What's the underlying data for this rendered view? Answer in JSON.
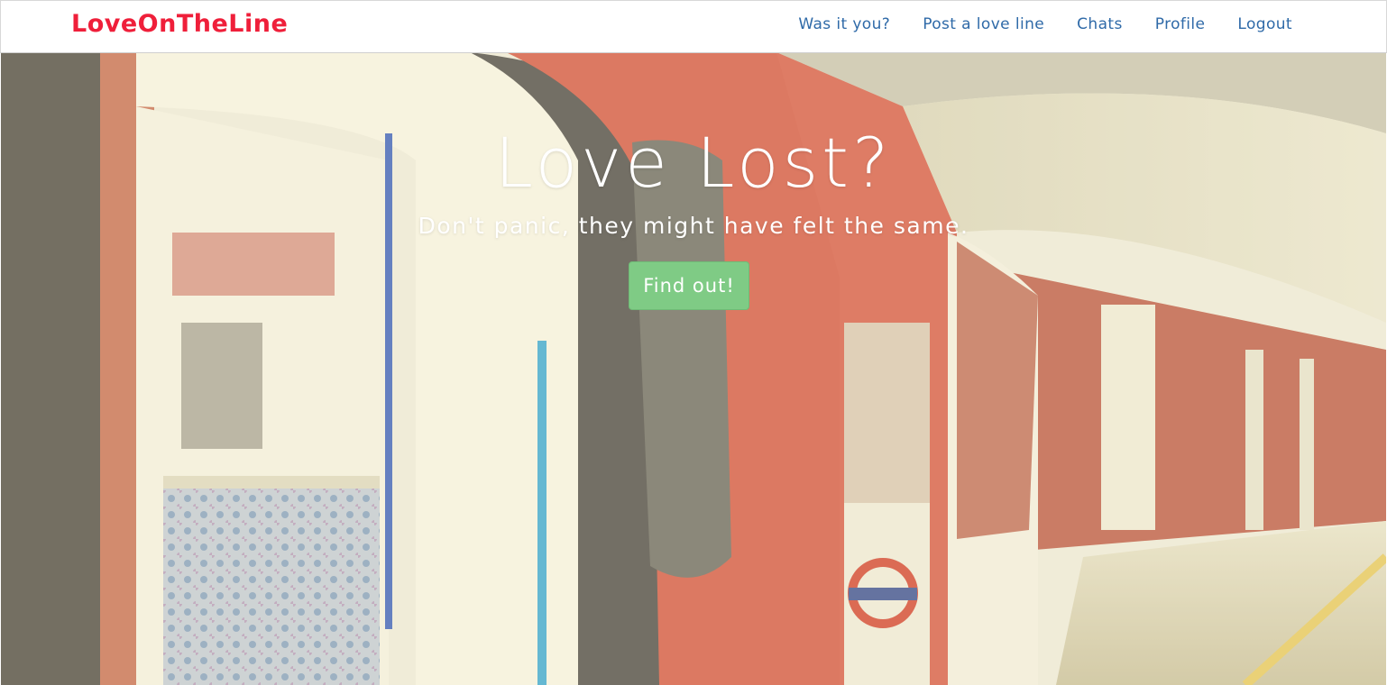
{
  "navbar": {
    "brand": "LoveOnTheLine",
    "links": [
      {
        "label": "Was it you?"
      },
      {
        "label": "Post a love line"
      },
      {
        "label": "Chats"
      },
      {
        "label": "Profile"
      },
      {
        "label": "Logout"
      }
    ]
  },
  "hero": {
    "title": "Love Lost?",
    "subtitle": "Don't panic, they might have felt the same.",
    "button_label": "Find out!",
    "background_image": "london-underground-train-photo"
  },
  "colors": {
    "brand": "#ef1f3a",
    "nav_link": "#2f6aa8",
    "cta": "#7fcb85"
  }
}
